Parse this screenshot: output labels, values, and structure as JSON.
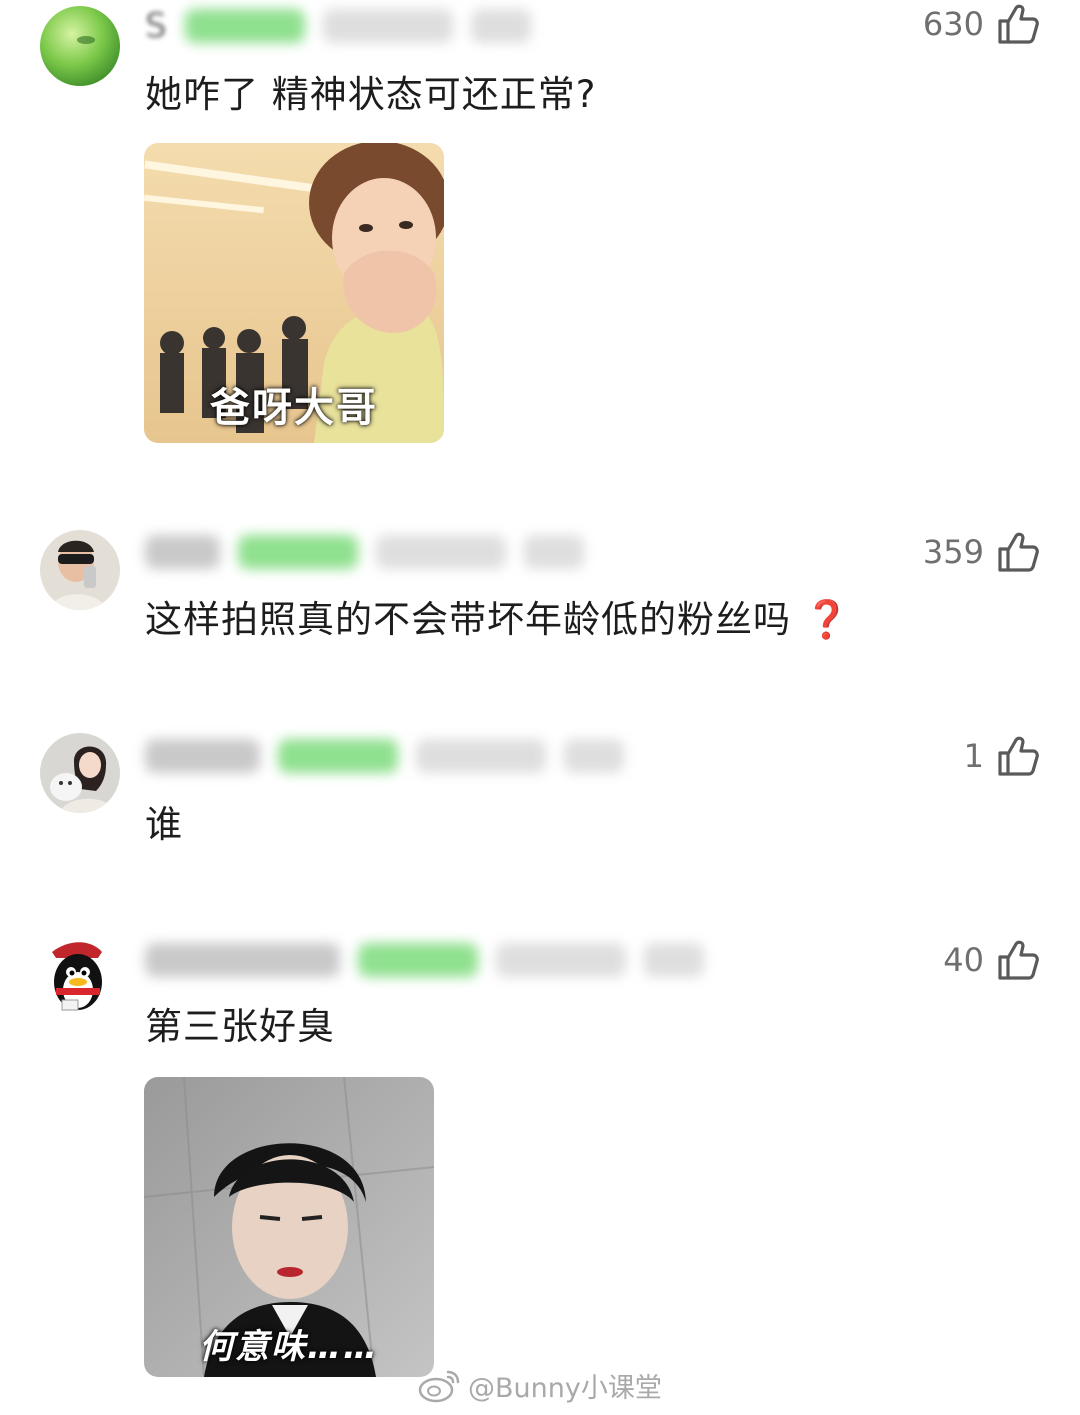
{
  "comments": [
    {
      "username_initial": "S",
      "likes": "630",
      "text": "她咋了 精神状态可还正常?",
      "sticker": {
        "caption": "爸呀大哥"
      }
    },
    {
      "likes": "359",
      "text": "这样拍照真的不会带坏年龄低的粉丝吗",
      "emoji": "❓"
    },
    {
      "likes": "1",
      "text": "谁"
    },
    {
      "likes": "40",
      "text": "第三张好臭",
      "sticker": {
        "caption": "何意味……"
      }
    }
  ],
  "watermark": {
    "text": "@Bunny小课堂",
    "icon": "weibo-logo-icon"
  },
  "icons": {
    "like": "thumbs-up-icon"
  },
  "colors": {
    "question_mark": "#e0222b",
    "likes_text": "#6f6f6f",
    "blurred_badge": "#8fe08f"
  }
}
